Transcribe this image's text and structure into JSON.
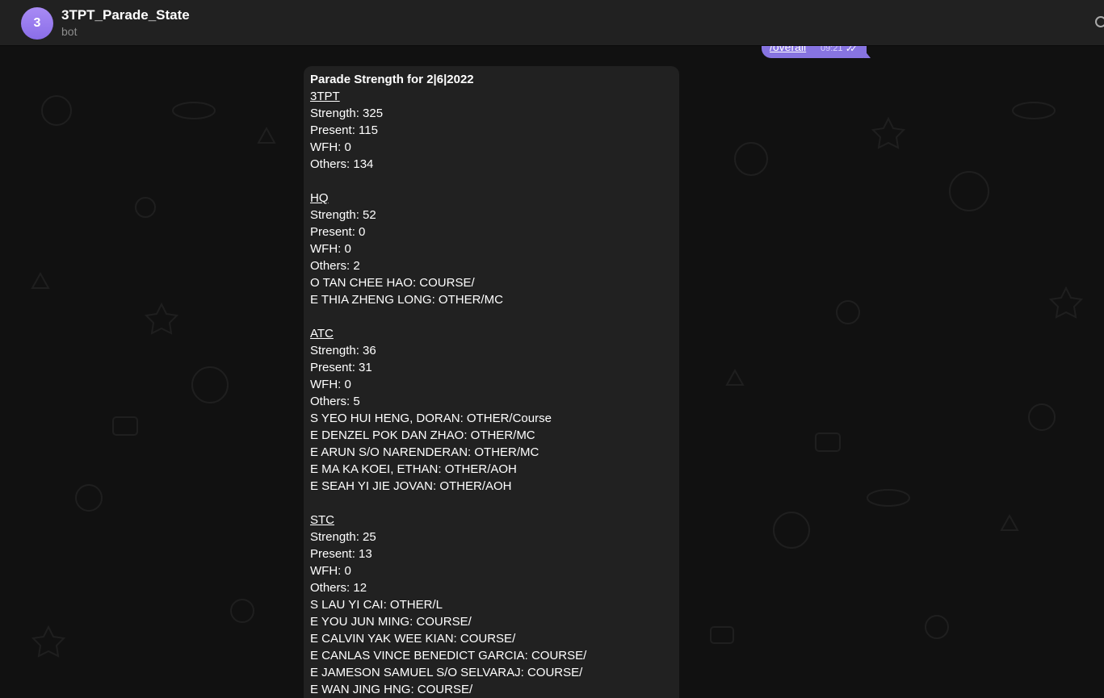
{
  "header": {
    "avatar_letter": "3",
    "title": "3TPT_Parade_State",
    "subtitle": "bot",
    "search_icon": "search-icon"
  },
  "outgoing": {
    "text": "/overall",
    "time": "09:21",
    "status_icon": "double-check-icon"
  },
  "message": {
    "title": "Parade Strength for 2|6|2022",
    "lines": [
      {
        "text": "3TPT",
        "style": "underline"
      },
      {
        "text": "Strength: 325",
        "style": ""
      },
      {
        "text": "Present: 115",
        "style": ""
      },
      {
        "text": "WFH: 0",
        "style": ""
      },
      {
        "text": "Others: 134",
        "style": ""
      },
      {
        "text": "",
        "style": "blank"
      },
      {
        "text": "HQ",
        "style": "underline"
      },
      {
        "text": "Strength: 52",
        "style": ""
      },
      {
        "text": "Present: 0",
        "style": ""
      },
      {
        "text": "WFH: 0",
        "style": ""
      },
      {
        "text": "Others: 2",
        "style": ""
      },
      {
        "text": "O TAN CHEE HAO: COURSE/",
        "style": ""
      },
      {
        "text": "E THIA ZHENG LONG: OTHER/MC",
        "style": ""
      },
      {
        "text": "",
        "style": "blank"
      },
      {
        "text": "ATC",
        "style": "underline"
      },
      {
        "text": "Strength: 36",
        "style": ""
      },
      {
        "text": "Present: 31",
        "style": ""
      },
      {
        "text": "WFH: 0",
        "style": ""
      },
      {
        "text": "Others: 5",
        "style": ""
      },
      {
        "text": "S YEO HUI HENG, DORAN: OTHER/Course",
        "style": ""
      },
      {
        "text": "E DENZEL POK DAN ZHAO: OTHER/MC",
        "style": ""
      },
      {
        "text": "E ARUN S/O NARENDERAN: OTHER/MC",
        "style": ""
      },
      {
        "text": "E MA KA KOEI, ETHAN: OTHER/AOH",
        "style": ""
      },
      {
        "text": "E SEAH YI JIE JOVAN: OTHER/AOH",
        "style": ""
      },
      {
        "text": "",
        "style": "blank"
      },
      {
        "text": "STC",
        "style": "underline"
      },
      {
        "text": "Strength: 25",
        "style": ""
      },
      {
        "text": "Present: 13",
        "style": ""
      },
      {
        "text": "WFH: 0",
        "style": ""
      },
      {
        "text": "Others: 12",
        "style": ""
      },
      {
        "text": "S LAU YI CAI: OTHER/L",
        "style": ""
      },
      {
        "text": "E YOU JUN MING: COURSE/",
        "style": ""
      },
      {
        "text": "E CALVIN YAK WEE KIAN: COURSE/",
        "style": ""
      },
      {
        "text": "E CANLAS VINCE BENEDICT GARCIA: COURSE/",
        "style": ""
      },
      {
        "text": "E JAMESON SAMUEL S/O SELVARAJ: COURSE/",
        "style": ""
      },
      {
        "text": "E WAN JING HNG: COURSE/",
        "style": ""
      }
    ]
  },
  "colors": {
    "accent": "#8774e1",
    "header_bg": "#212121",
    "bubble_bg": "#212121",
    "chat_bg": "#111111"
  }
}
